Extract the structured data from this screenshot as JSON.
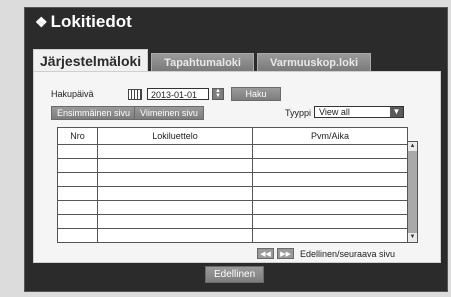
{
  "window": {
    "title": "Lokitiedot"
  },
  "tabs": [
    {
      "label": "Järjestelmäloki",
      "active": true
    },
    {
      "label": "Tapahtumaloki",
      "active": false
    },
    {
      "label": "Varmuuskop.loki",
      "active": false
    }
  ],
  "search": {
    "date_label": "Hakupäivä",
    "date_value": "2013-01-01",
    "search_button": "Haku",
    "first_page_button": "Ensimmäinen sivu",
    "last_page_button": "Viimeinen sivu",
    "type_label": "Tyyppi",
    "type_value": "View all"
  },
  "table": {
    "headers": [
      "Nro",
      "Lokiluettelo",
      "Pvm/Aika"
    ],
    "row_count": 8
  },
  "pagination": {
    "label": "Edellinen/seuraava sivu"
  },
  "footer": {
    "back_button": "Edellinen"
  },
  "icons": [
    "diamond-icon",
    "calendar-icon",
    "spinner-icon",
    "dropdown-arrow-icon",
    "scroll-up-icon",
    "scroll-down-icon",
    "prev-page-icon",
    "next-page-icon"
  ]
}
